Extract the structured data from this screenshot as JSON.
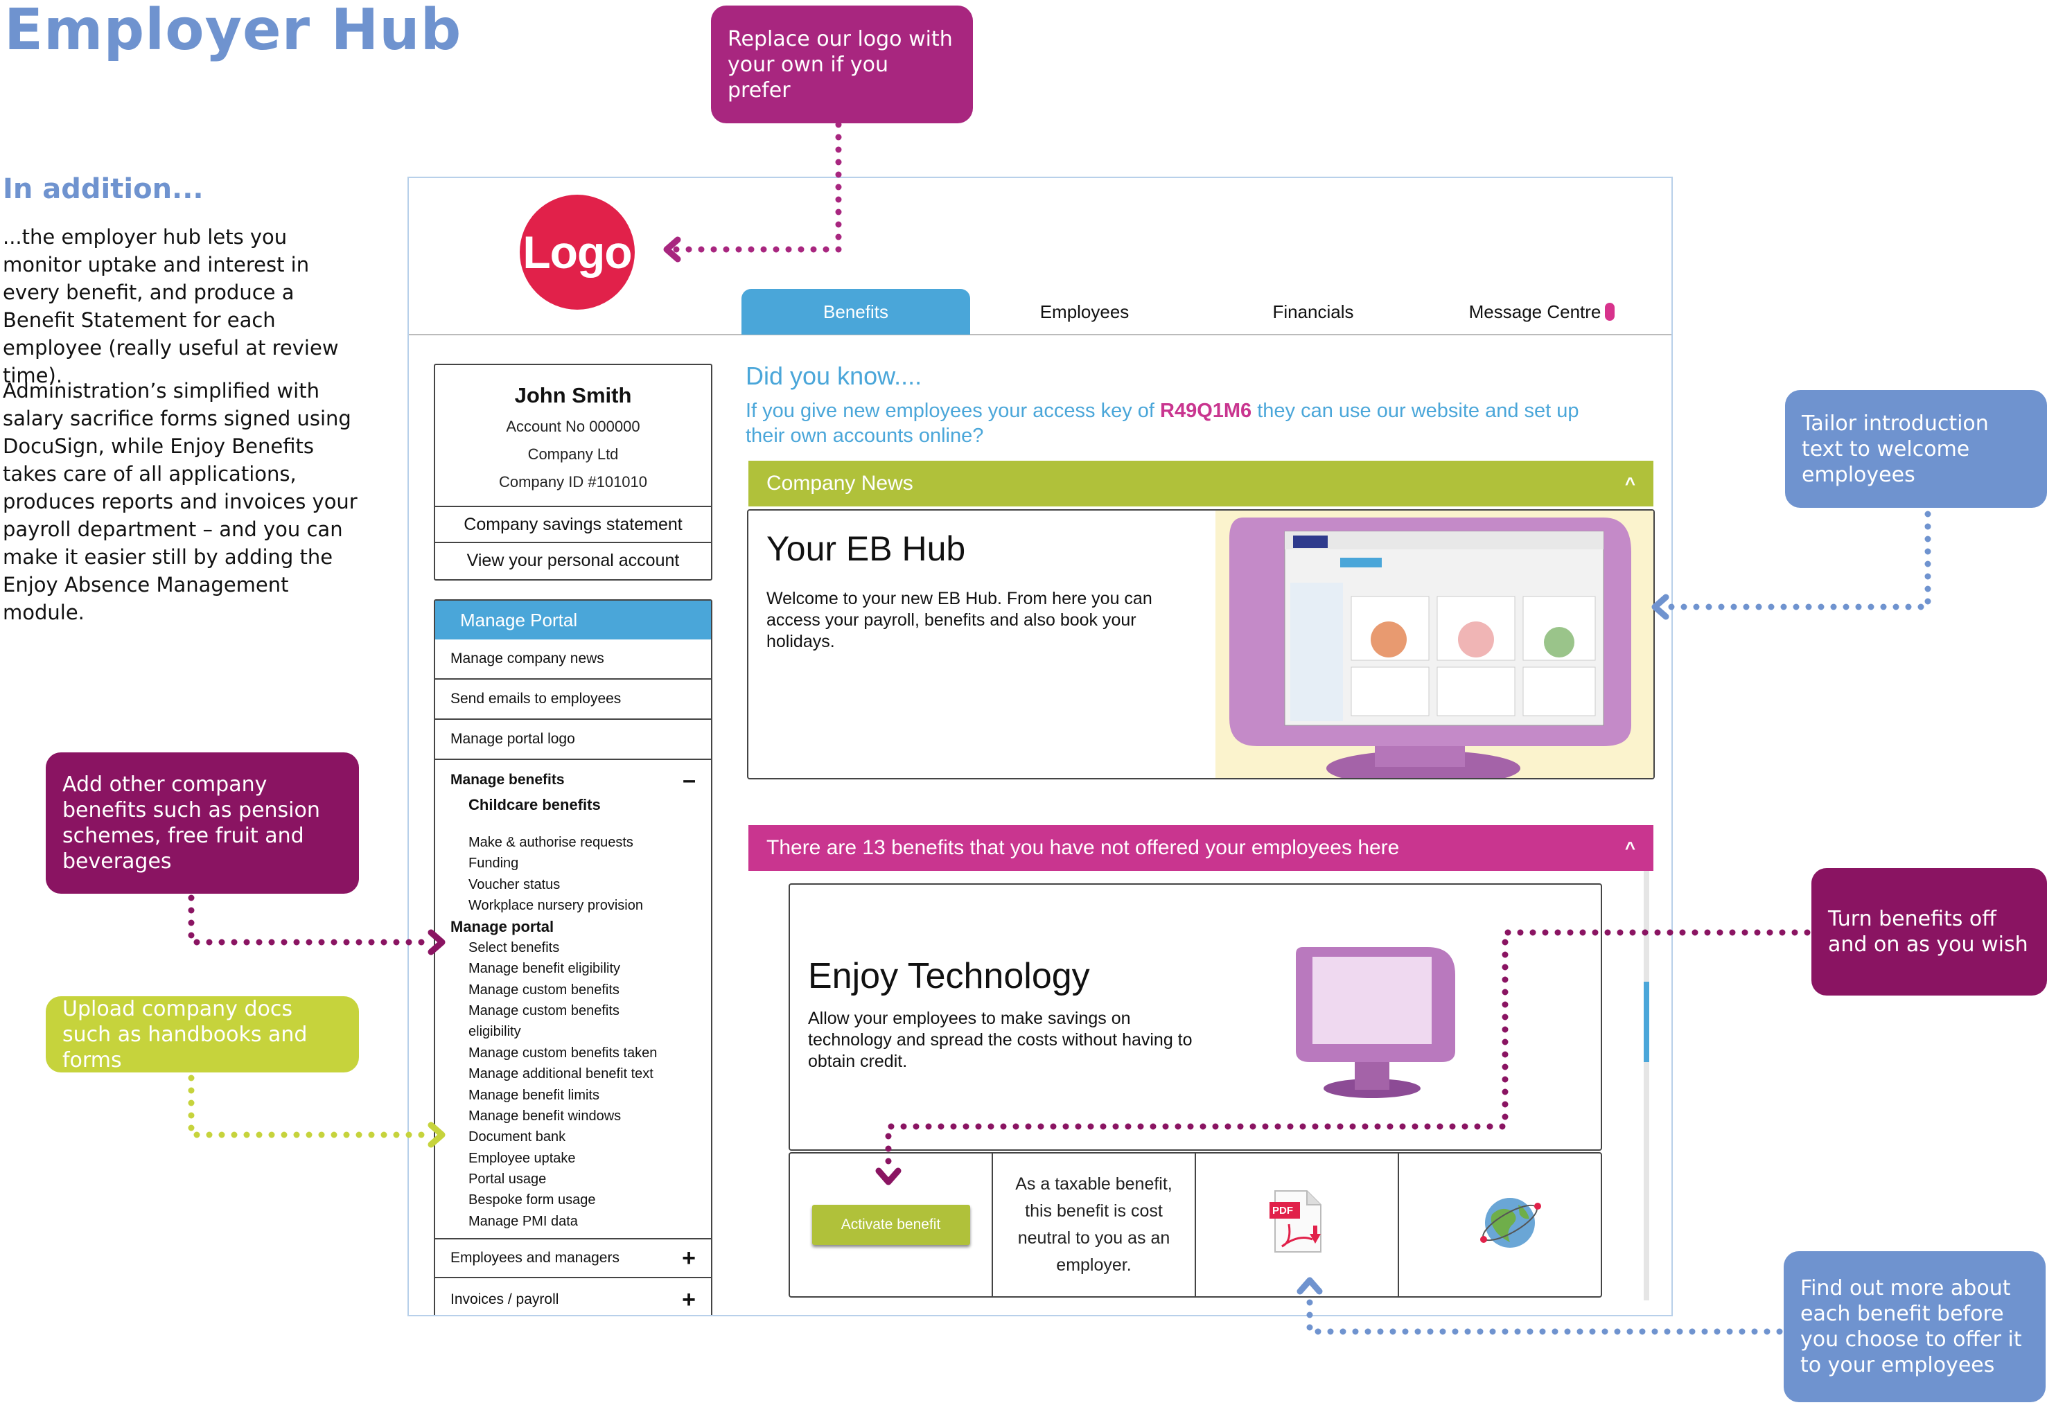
{
  "doc": {
    "title": "Employer Hub",
    "subtitle": "In addition...",
    "intro_1": "...the employer hub lets you monitor uptake and interest in every benefit, and produce a Benefit Statement for each employee (really useful at review time).",
    "intro_2": "Administration’s simplified with salary sacrifice forms signed using DocuSign, while Enjoy Benefits takes care of all applications, produces reports and invoices your payroll department – and you can make it easier still by adding the Enjoy Absence Management module."
  },
  "callouts": {
    "logo": "Replace our logo with your own if you prefer",
    "intro_text": "Tailor introduction text to welcome employees",
    "add_benefits": "Add other company benefits such as pension schemes, free fruit and beverages",
    "upload_docs": "Upload company docs such as handbooks and forms",
    "toggle": "Turn benefits off and on as you wish",
    "find_out": "Find out more about each benefit before you choose to offer it to your employees"
  },
  "app": {
    "logo_text": "Logo",
    "tabs": [
      "Benefits",
      "Employees",
      "Financials",
      "Message Centre"
    ],
    "account": {
      "name": "John Smith",
      "account_no": "Account No 000000",
      "company": "Company Ltd",
      "company_id": "Company ID #101010",
      "savings_link": "Company savings statement",
      "personal_link": "View your personal account"
    },
    "portal": {
      "heading": "Manage Portal",
      "rows": [
        "Manage company news",
        "Send emails to employees",
        "Manage portal logo"
      ],
      "manage_benefits": "Manage benefits",
      "childcare": "Childcare benefits",
      "childcare_items": [
        "Make & authorise requests",
        "Funding",
        "Voucher status",
        "Workplace nursery provision"
      ],
      "manage_portal": "Manage portal",
      "portal_items": [
        "Select benefits",
        "Manage benefit eligibility",
        "Manage custom benefits",
        "Manage custom benefits",
        "eligibility",
        "Manage custom benefits taken",
        "Manage additional benefit text",
        "Manage benefit limits",
        "Manage benefit windows",
        "Document bank",
        "Employee uptake",
        "Portal usage",
        "Bespoke form usage",
        "Manage PMI data"
      ],
      "employees_managers": "Employees and managers",
      "invoices": "Invoices / payroll"
    },
    "did_you_know": "Did you know....",
    "key_pre": "If you give new employees your access key of ",
    "key": "R49Q1M6",
    "key_post": " they can use our website and set up their own accounts online?",
    "news_bar": "Company News",
    "news_title": "Your EB Hub",
    "news_body": "Welcome to your new EB Hub. From here you can access your payroll, benefits and also book your holidays.",
    "benefits_bar": "There are 13 benefits that you have not offered your employees here",
    "benefit_title": "Enjoy Technology",
    "benefit_desc": "Allow your employees to make savings on technology and spread the costs without having to obtain credit.",
    "activate": "Activate benefit",
    "tax_note": "As a taxable benefit, this benefit is cost neutral to you as an employer.",
    "pdf_label": "PDF"
  },
  "colors": {
    "title_blue": "#6f93cf",
    "tab_blue": "#4aa6d9",
    "news_green": "#b0c13a",
    "benefits_pink": "#c9358f",
    "logo_red": "#e1214a",
    "callout_magenta": "#a8267f",
    "callout_plum": "#8a1462",
    "callout_lime": "#c6d33c"
  }
}
